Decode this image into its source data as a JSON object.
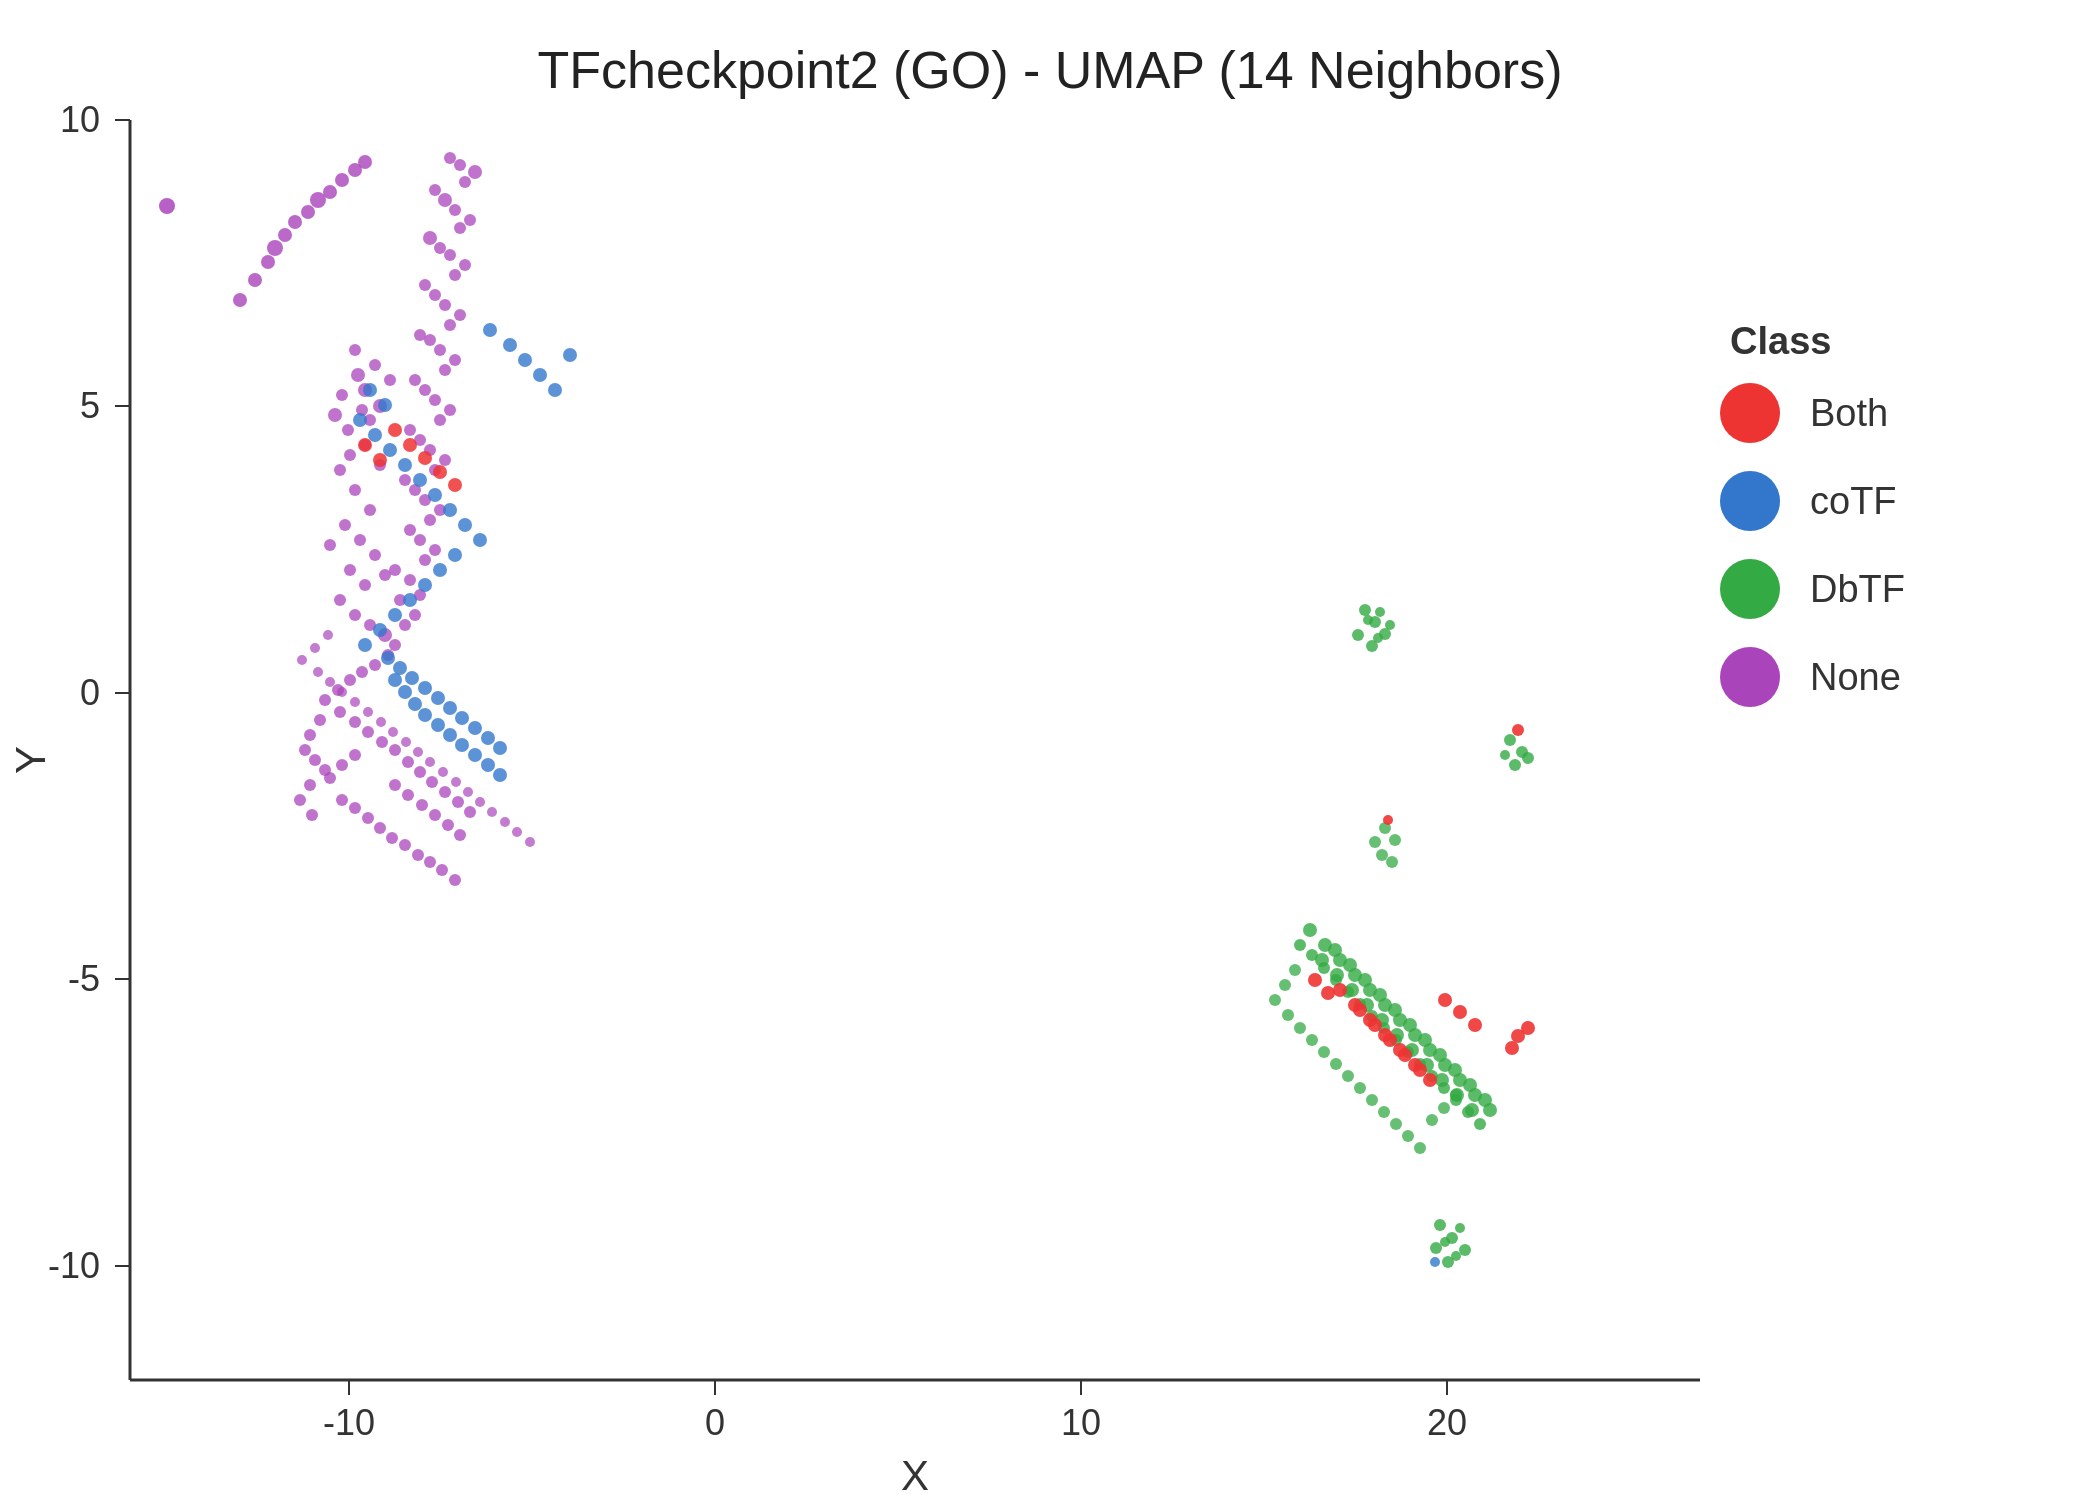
{
  "title": "TFcheckpoint2 (GO) - UMAP (14 Neighbors)",
  "xAxisLabel": "X",
  "yAxisLabel": "Y",
  "legend": {
    "title": "Class",
    "items": [
      {
        "label": "Both",
        "color": "#EE3333"
      },
      {
        "label": "coTF",
        "color": "#3377CC"
      },
      {
        "label": "DbTF",
        "color": "#33AA44"
      },
      {
        "label": "None",
        "color": "#AA44BB"
      }
    ]
  },
  "xRange": {
    "min": -16,
    "max": 27
  },
  "yRange": {
    "min": -12,
    "max": 10
  },
  "xTicks": [
    -10,
    0,
    10,
    20
  ],
  "yTicks": [
    -10,
    -5,
    0,
    5,
    10
  ]
}
